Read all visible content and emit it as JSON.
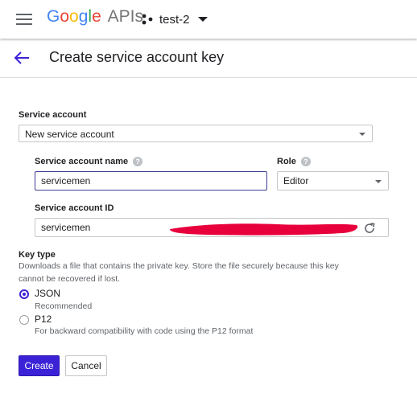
{
  "topbar": {
    "logo_parts": [
      "G",
      "o",
      "o",
      "g",
      "l",
      "e"
    ],
    "logo_suffix": "APIs",
    "project_name": "test-2"
  },
  "header": {
    "title": "Create service account key"
  },
  "form": {
    "service_account_label": "Service account",
    "service_account_value": "New service account",
    "service_account_name_label": "Service account name",
    "service_account_name_value": "servicemen",
    "role_label": "Role",
    "role_value": "Editor",
    "service_account_id_label": "Service account ID",
    "service_account_id_value": "servicemen",
    "key_type_label": "Key type",
    "key_type_description": "Downloads a file that contains the private key. Store the file securely because this key cannot be recovered if lost.",
    "options": [
      {
        "label": "JSON",
        "sublabel": "Recommended",
        "selected": true
      },
      {
        "label": "P12",
        "sublabel": "For backward compatibility with code using the P12 format",
        "selected": false
      }
    ]
  },
  "buttons": {
    "create": "Create",
    "cancel": "Cancel"
  },
  "colors": {
    "primary": "#3c22d6",
    "redaction": "#e8003d"
  }
}
